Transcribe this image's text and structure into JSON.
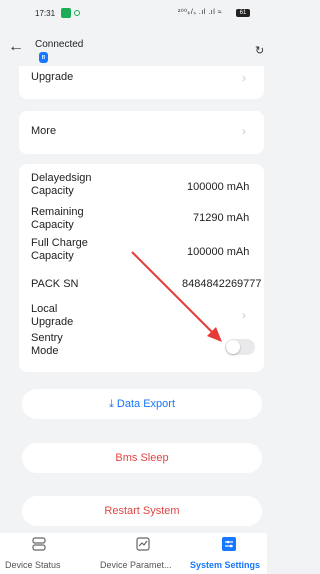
{
  "status_bar": {
    "time": "17:31",
    "network": "²⁰⁰ₖ/ₛ .ıl .ıl ≈",
    "battery": "61"
  },
  "header": {
    "title": "Connected",
    "bt_glyph": "ʙ"
  },
  "rows": {
    "upgrade": "Upgrade",
    "more": "More",
    "delayed_label": "Delayedsign Capacity",
    "delayed_value": "100000 mAh",
    "remaining_label": "Remaining Capacity",
    "remaining_value": "71290 mAh",
    "fullcharge_label": "Full Charge Capacity",
    "fullcharge_value": "100000 mAh",
    "pack_sn_label": "PACK SN",
    "pack_sn_value": "8484842269777",
    "local_upgrade": "Local Upgrade",
    "sentry_mode": "Sentry Mode",
    "sentry_on": false
  },
  "buttons": {
    "data_export": "Data Export",
    "bms_sleep": "Bms Sleep",
    "restart": "Restart System"
  },
  "tabs": [
    {
      "label": "Device Status",
      "active": false
    },
    {
      "label": "Device Paramet...",
      "active": false
    },
    {
      "label": "System Settings",
      "active": true
    }
  ],
  "colors": {
    "accent": "#1677ff",
    "danger": "#e04545",
    "annotation_arrow": "#e53935"
  }
}
